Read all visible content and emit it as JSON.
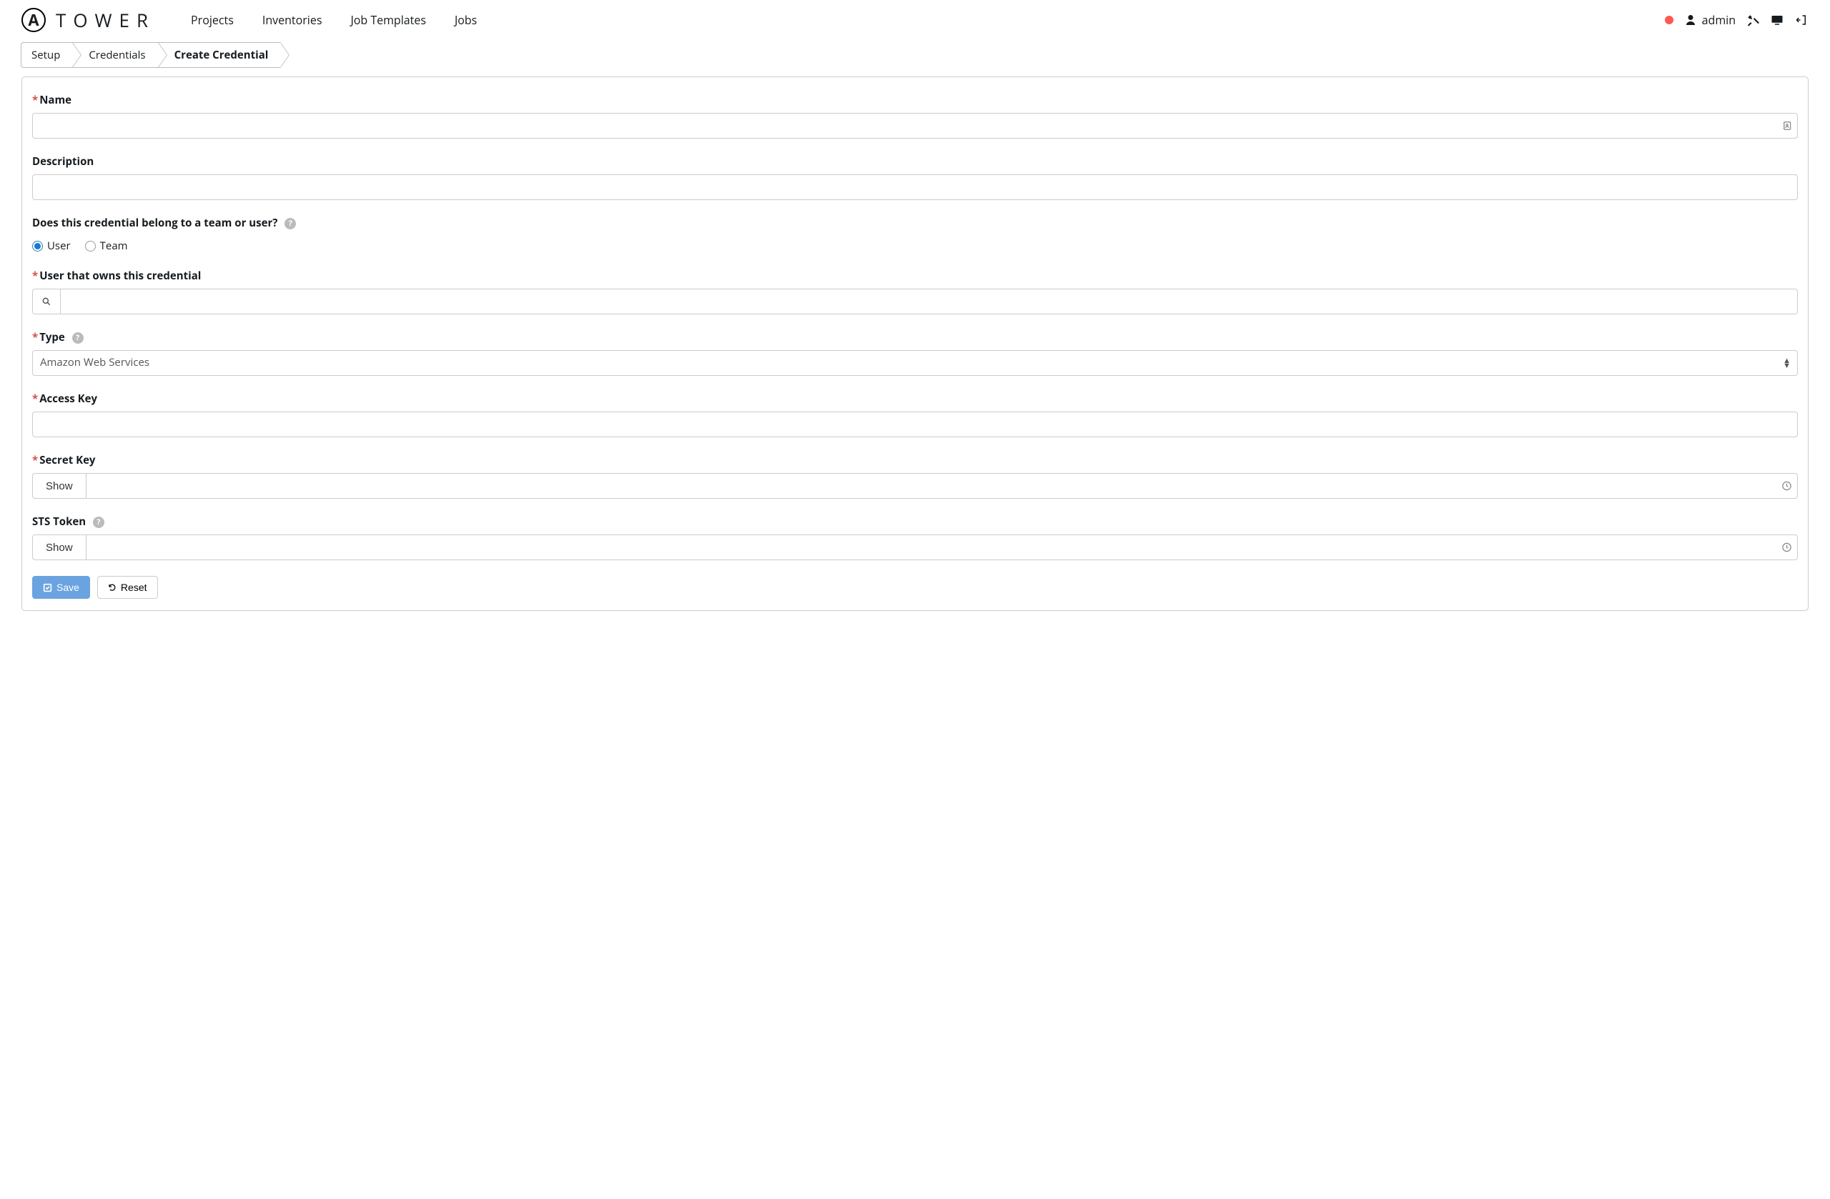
{
  "brand": {
    "logo_letter": "A",
    "name": "TOWER"
  },
  "nav": {
    "projects": "Projects",
    "inventories": "Inventories",
    "job_templates": "Job Templates",
    "jobs": "Jobs"
  },
  "user": {
    "name": "admin"
  },
  "breadcrumbs": {
    "setup": "Setup",
    "credentials": "Credentials",
    "create": "Create Credential"
  },
  "form": {
    "name": {
      "label": "Name",
      "value": ""
    },
    "description": {
      "label": "Description",
      "value": ""
    },
    "owner_question": "Does this credential belong to a team or user?",
    "owner_options": {
      "user": "User",
      "team": "Team",
      "selected": "user"
    },
    "owner_user": {
      "label": "User that owns this credential",
      "value": ""
    },
    "type": {
      "label": "Type",
      "value": "Amazon Web Services"
    },
    "access_key": {
      "label": "Access Key",
      "value": ""
    },
    "secret_key": {
      "label": "Secret Key",
      "value": "",
      "show": "Show"
    },
    "sts_token": {
      "label": "STS Token",
      "value": "",
      "show": "Show"
    }
  },
  "buttons": {
    "save": "Save",
    "reset": "Reset"
  }
}
